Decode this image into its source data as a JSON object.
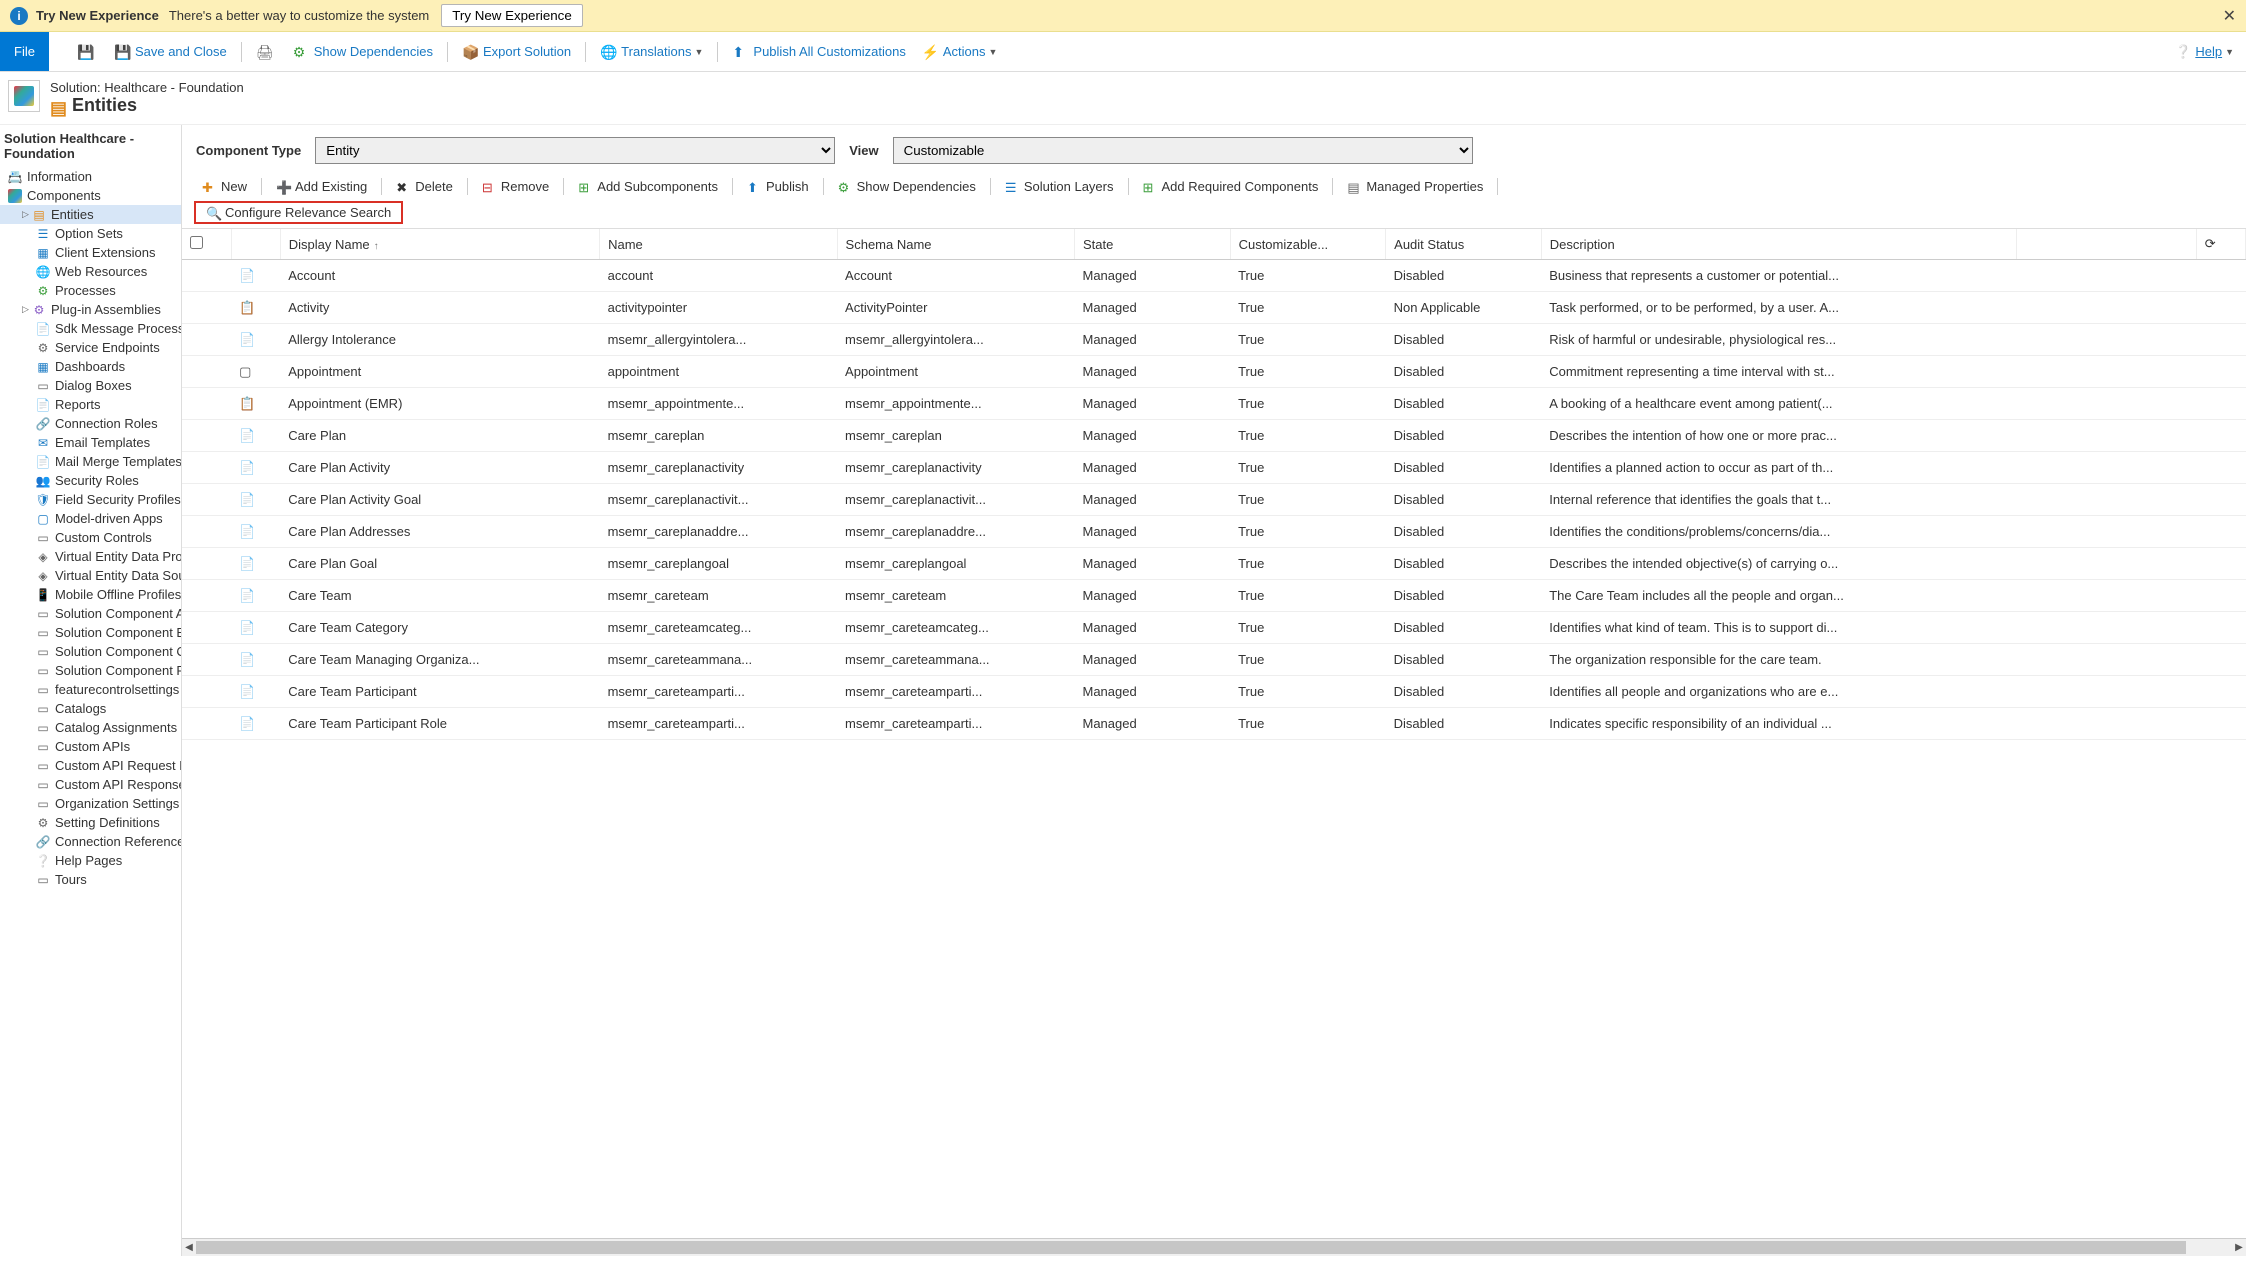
{
  "banner": {
    "title": "Try New Experience",
    "subtitle": "There's a better way to customize the system",
    "button": "Try New Experience"
  },
  "toolbar": {
    "file": "File",
    "save_close": "Save and Close",
    "show_dependencies": "Show Dependencies",
    "export_solution": "Export Solution",
    "translations": "Translations",
    "publish_all": "Publish All Customizations",
    "actions": "Actions",
    "help": "Help"
  },
  "header": {
    "breadcrumb": "Solution: Healthcare - Foundation",
    "title": "Entities"
  },
  "sidebar": {
    "title": "Solution Healthcare - Foundation",
    "information": "Information",
    "components": "Components",
    "entities": "Entities",
    "option_sets": "Option Sets",
    "client_extensions": "Client Extensions",
    "web_resources": "Web Resources",
    "processes": "Processes",
    "plugin_assemblies": "Plug-in Assemblies",
    "sdk_message": "Sdk Message Processin...",
    "service_endpoints": "Service Endpoints",
    "dashboards": "Dashboards",
    "dialog_boxes": "Dialog Boxes",
    "reports": "Reports",
    "connection_roles": "Connection Roles",
    "email_templates": "Email Templates",
    "mail_merge": "Mail Merge Templates",
    "security_roles": "Security Roles",
    "field_security": "Field Security Profiles",
    "model_driven": "Model-driven Apps",
    "custom_controls": "Custom Controls",
    "virtual_entity_prov": "Virtual Entity Data Prov...",
    "virtual_entity_sour": "Virtual Entity Data Sour...",
    "mobile_offline": "Mobile Offline Profiles",
    "sol_comp_a": "Solution Component A...",
    "sol_comp_b": "Solution Component B...",
    "sol_comp_c": "Solution Component C...",
    "sol_comp_r": "Solution Component R...",
    "feature_settings": "featurecontrolsettings",
    "catalogs": "Catalogs",
    "catalog_assign": "Catalog Assignments",
    "custom_apis": "Custom APIs",
    "custom_api_req": "Custom API Request Pa...",
    "custom_api_res": "Custom API Response ...",
    "org_settings": "Organization Settings",
    "setting_def": "Setting Definitions",
    "conn_ref": "Connection References",
    "help_pages": "Help Pages",
    "tours": "Tours"
  },
  "filters": {
    "component_type_label": "Component Type",
    "component_type_value": "Entity",
    "view_label": "View",
    "view_value": "Customizable"
  },
  "actions": {
    "new": "New",
    "add_existing": "Add Existing",
    "delete": "Delete",
    "remove": "Remove",
    "add_subcomponents": "Add Subcomponents",
    "publish": "Publish",
    "show_dependencies": "Show Dependencies",
    "solution_layers": "Solution Layers",
    "add_required": "Add Required Components",
    "managed_properties": "Managed Properties",
    "configure_relevance": "Configure Relevance Search"
  },
  "grid": {
    "columns": {
      "display_name": "Display Name",
      "name": "Name",
      "schema_name": "Schema Name",
      "state": "State",
      "customizable": "Customizable...",
      "audit_status": "Audit Status",
      "description": "Description"
    },
    "rows": [
      {
        "display": "Account",
        "name": "account",
        "schema": "Account",
        "state": "Managed",
        "cust": "True",
        "audit": "Disabled",
        "desc": "Business that represents a customer or potential..."
      },
      {
        "display": "Activity",
        "name": "activitypointer",
        "schema": "ActivityPointer",
        "state": "Managed",
        "cust": "True",
        "audit": "Non Applicable",
        "desc": "Task performed, or to be performed, by a user. A..."
      },
      {
        "display": "Allergy Intolerance",
        "name": "msemr_allergyintolera...",
        "schema": "msemr_allergyintolera...",
        "state": "Managed",
        "cust": "True",
        "audit": "Disabled",
        "desc": "Risk of harmful or undesirable, physiological res..."
      },
      {
        "display": "Appointment",
        "name": "appointment",
        "schema": "Appointment",
        "state": "Managed",
        "cust": "True",
        "audit": "Disabled",
        "desc": "Commitment representing a time interval with st..."
      },
      {
        "display": "Appointment (EMR)",
        "name": "msemr_appointmente...",
        "schema": "msemr_appointmente...",
        "state": "Managed",
        "cust": "True",
        "audit": "Disabled",
        "desc": "A booking of a healthcare event among patient(..."
      },
      {
        "display": "Care Plan",
        "name": "msemr_careplan",
        "schema": "msemr_careplan",
        "state": "Managed",
        "cust": "True",
        "audit": "Disabled",
        "desc": "Describes the intention of how one or more prac..."
      },
      {
        "display": "Care Plan Activity",
        "name": "msemr_careplanactivity",
        "schema": "msemr_careplanactivity",
        "state": "Managed",
        "cust": "True",
        "audit": "Disabled",
        "desc": "Identifies a planned action to occur as part of th..."
      },
      {
        "display": "Care Plan Activity Goal",
        "name": "msemr_careplanactivit...",
        "schema": "msemr_careplanactivit...",
        "state": "Managed",
        "cust": "True",
        "audit": "Disabled",
        "desc": "Internal reference that identifies the goals that t..."
      },
      {
        "display": "Care Plan Addresses",
        "name": "msemr_careplanaddre...",
        "schema": "msemr_careplanaddre...",
        "state": "Managed",
        "cust": "True",
        "audit": "Disabled",
        "desc": "Identifies the conditions/problems/concerns/dia..."
      },
      {
        "display": "Care Plan Goal",
        "name": "msemr_careplangoal",
        "schema": "msemr_careplangoal",
        "state": "Managed",
        "cust": "True",
        "audit": "Disabled",
        "desc": "Describes the intended objective(s) of carrying o..."
      },
      {
        "display": "Care Team",
        "name": "msemr_careteam",
        "schema": "msemr_careteam",
        "state": "Managed",
        "cust": "True",
        "audit": "Disabled",
        "desc": "The Care Team includes all the people and organ..."
      },
      {
        "display": "Care Team Category",
        "name": "msemr_careteamcateg...",
        "schema": "msemr_careteamcateg...",
        "state": "Managed",
        "cust": "True",
        "audit": "Disabled",
        "desc": "Identifies what kind of team. This is to support di..."
      },
      {
        "display": "Care Team Managing Organiza...",
        "name": "msemr_careteammana...",
        "schema": "msemr_careteammana...",
        "state": "Managed",
        "cust": "True",
        "audit": "Disabled",
        "desc": "The organization responsible for the care team."
      },
      {
        "display": "Care Team Participant",
        "name": "msemr_careteamparti...",
        "schema": "msemr_careteamparti...",
        "state": "Managed",
        "cust": "True",
        "audit": "Disabled",
        "desc": "Identifies all people and organizations who are e..."
      },
      {
        "display": "Care Team Participant Role",
        "name": "msemr_careteamparti...",
        "schema": "msemr_careteamparti...",
        "state": "Managed",
        "cust": "True",
        "audit": "Disabled",
        "desc": "Indicates specific responsibility of an individual ..."
      }
    ]
  }
}
